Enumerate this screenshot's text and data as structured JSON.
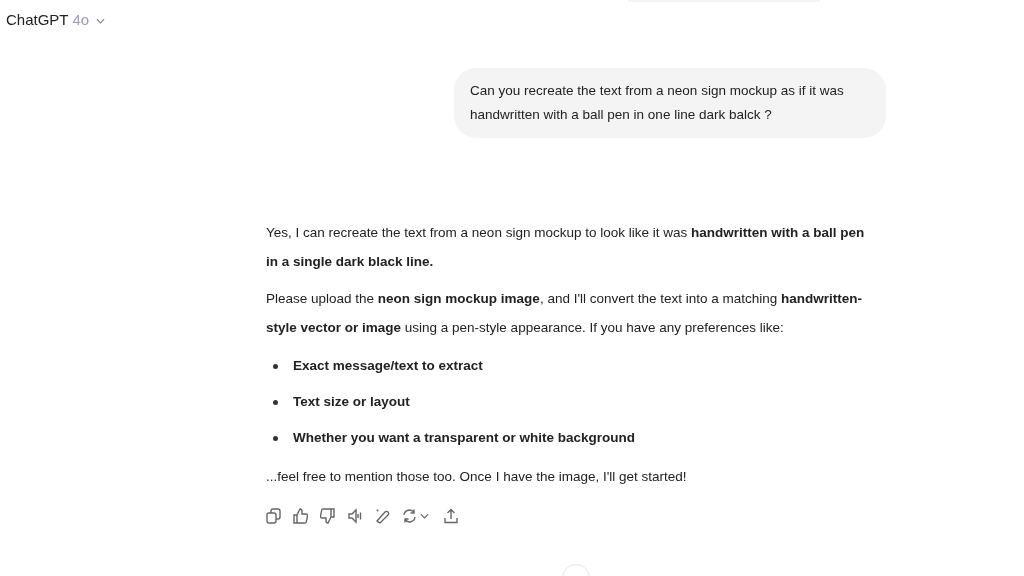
{
  "header": {
    "model": "ChatGPT",
    "version": "4o"
  },
  "user_message": "Can you recreate the text from a neon sign mockup as if it was handwritten with a ball pen in one line dark balck ?",
  "assistant_message": {
    "paragraphs": [
      "Yes, I can recreate the text from a neon sign mockup to look like it was **handwritten with a ball pen in a single dark black line.**",
      "Please upload the **neon sign mockup image**, and I'll convert the text into a matching **handwritten-style vector or image** using a pen-style appearance. If you have any preferences like:"
    ],
    "bullets": [
      "Exact message/text to extract",
      "Text size or layout",
      "Whether you want a transparent or white background"
    ],
    "closing": "...feel free to mention those too. Once I have the image, I'll get started!"
  }
}
